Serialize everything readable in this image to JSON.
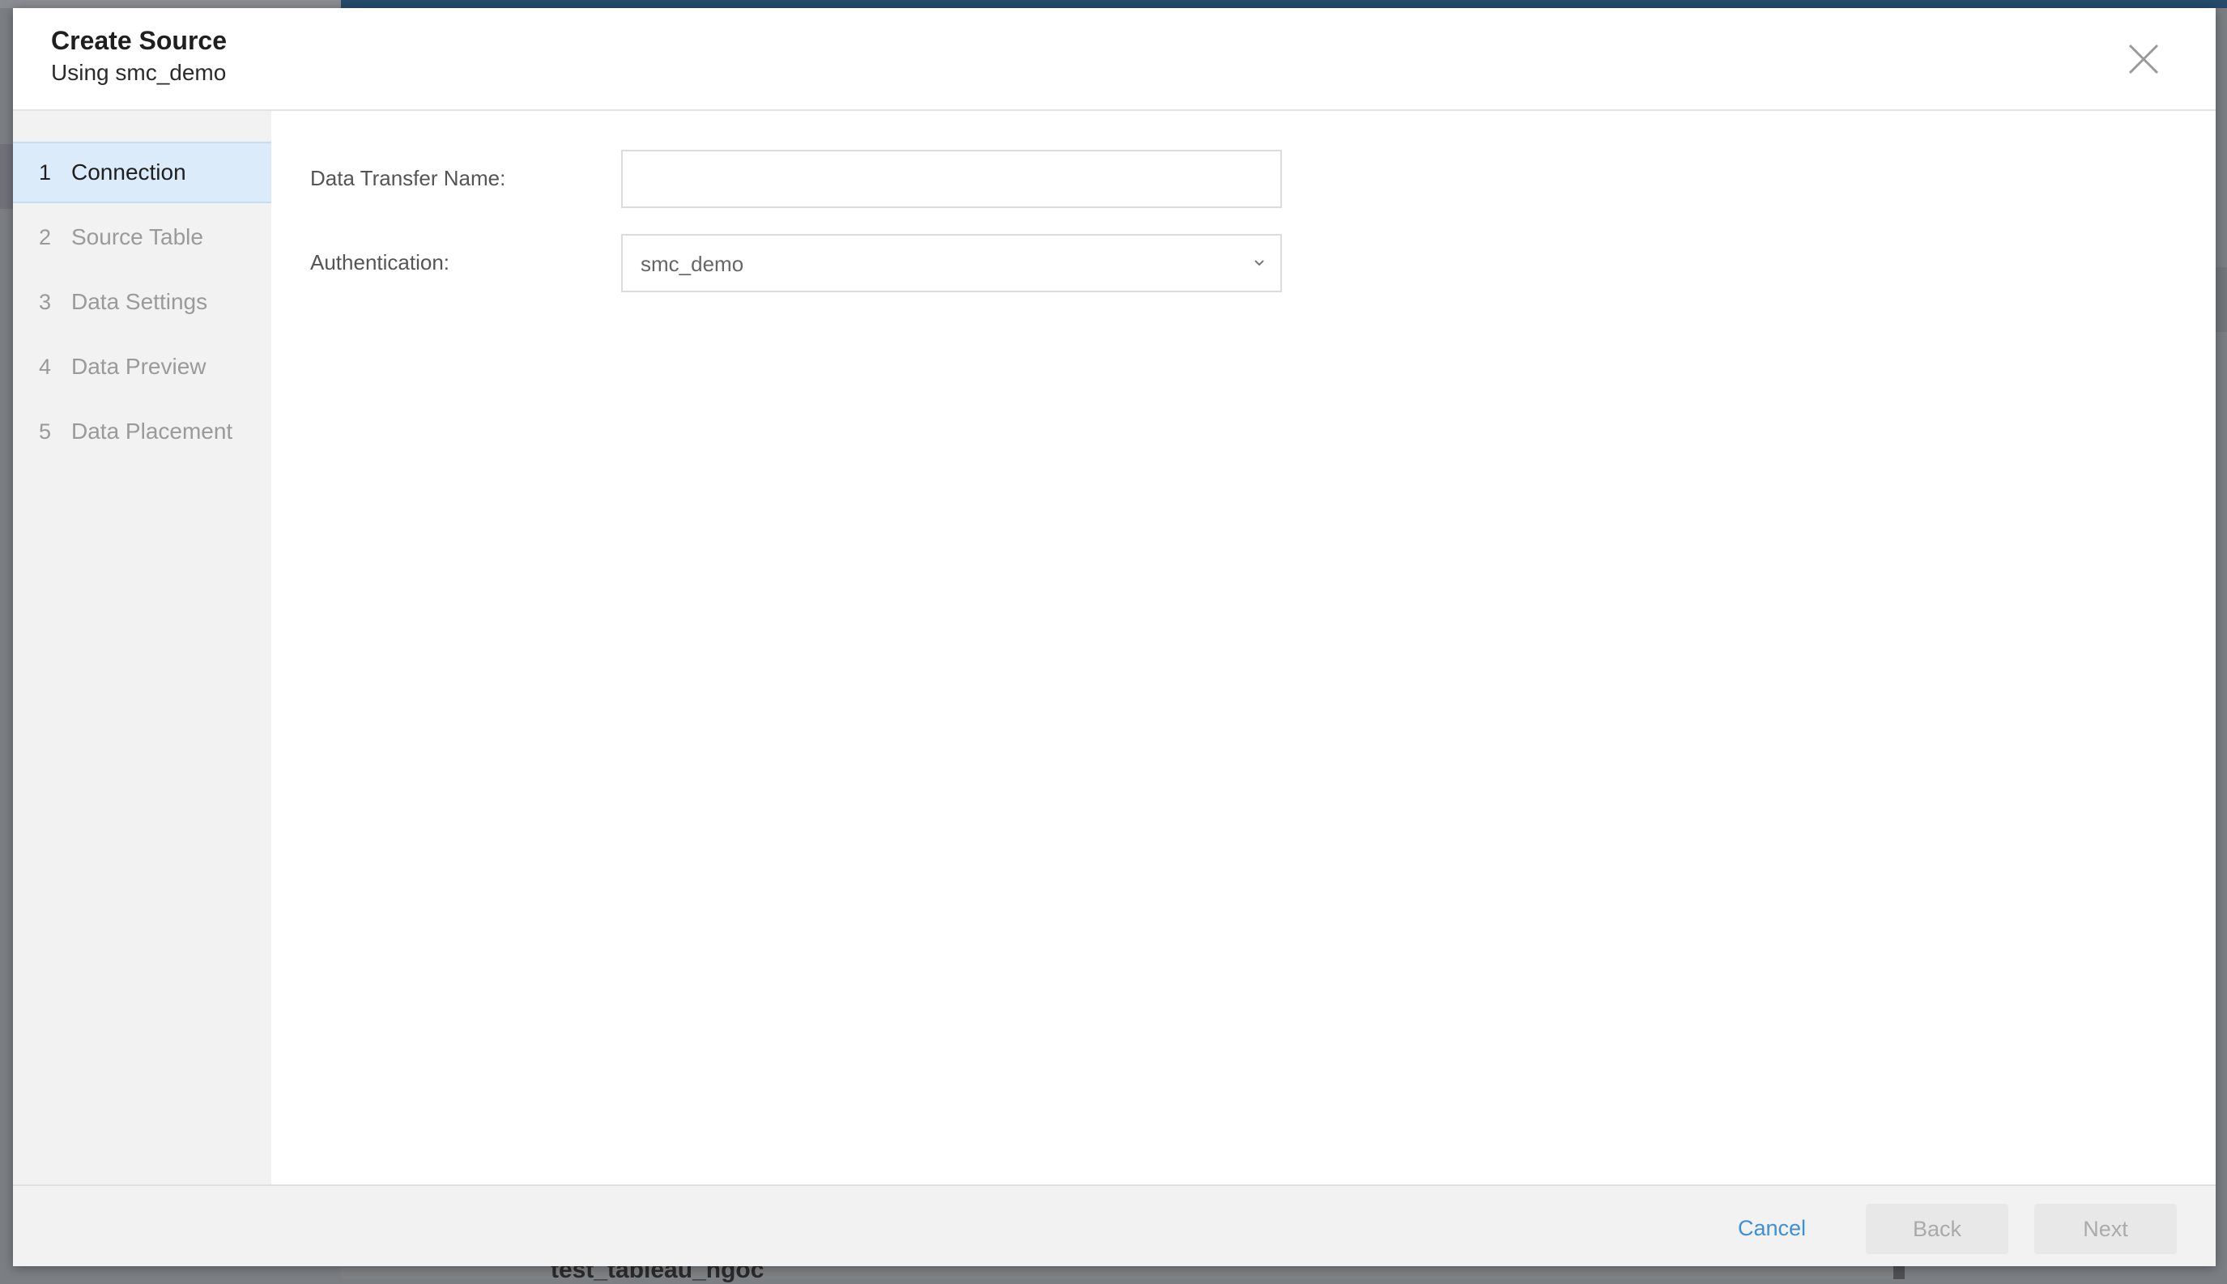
{
  "background": {
    "row_text": "test_tableau_ngoc"
  },
  "dialog": {
    "title": "Create Source",
    "subtitle": "Using smc_demo",
    "close_icon": "close-icon"
  },
  "steps": [
    {
      "num": "1",
      "label": "Connection",
      "active": true
    },
    {
      "num": "2",
      "label": "Source Table",
      "active": false
    },
    {
      "num": "3",
      "label": "Data Settings",
      "active": false
    },
    {
      "num": "4",
      "label": "Data Preview",
      "active": false
    },
    {
      "num": "5",
      "label": "Data Placement",
      "active": false
    }
  ],
  "form": {
    "name_label": "Data Transfer Name:",
    "name_value": "",
    "auth_label": "Authentication:",
    "auth_value": "smc_demo",
    "auth_icon": "chevron-down-icon"
  },
  "footer": {
    "cancel_label": "Cancel",
    "back_label": "Back",
    "next_label": "Next"
  },
  "colors": {
    "accent": "#3d8fd6",
    "active_step_bg": "#dcebf9",
    "top_bar": "#254a6b"
  }
}
